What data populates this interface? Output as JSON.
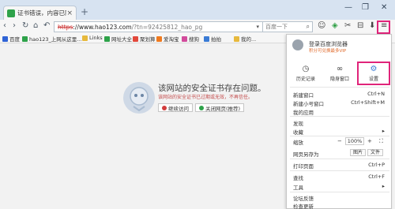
{
  "tab": {
    "label": "证书错误，内容已阻止"
  },
  "window": {
    "minimize": "—",
    "restore": "❐",
    "close": "✕"
  },
  "toolbar": {
    "url_scheme": "https",
    "url_host": "://www.hao123.com",
    "url_rest": "/?tn=92425812_hao_pg",
    "search_placeholder": "百度一下"
  },
  "bookmarks": [
    {
      "label": "百度",
      "color": "#3064d6"
    },
    {
      "label": "hao123_上网从这里...",
      "color": "#2ea24a"
    },
    {
      "label": "Links",
      "color": "#e7b93d"
    },
    {
      "label": "网址大全",
      "color": "#2ea24a"
    },
    {
      "label": "聚划算",
      "color": "#e2483c"
    },
    {
      "label": "爱淘宝",
      "color": "#f07a1f"
    },
    {
      "label": "搜狗",
      "color": "#d24b9c"
    },
    {
      "label": "拍拍",
      "color": "#3a7bd5"
    },
    {
      "label": "我的...",
      "color": "#e7b93d"
    }
  ],
  "error": {
    "title": "该网站的安全证书存在问题。",
    "subtitle": "该网站的安全证书已过期或无效，不再信任。",
    "continue_label": "继续访问",
    "close_label": "关闭网页(推荐)"
  },
  "menu": {
    "login_title": "登录百度浏览器",
    "login_sub": "积分可兑换最多VIP",
    "quick": {
      "history": "历史记录",
      "incognito": "隐身窗口",
      "settings": "设置"
    },
    "items": [
      {
        "label": "新建窗口",
        "shortcut": "Ctrl+N"
      },
      {
        "label": "新建小号窗口",
        "shortcut": "Ctrl+Shift+M"
      },
      {
        "label": "我的应用",
        "shortcut": ""
      },
      {
        "label": "发现",
        "shortcut": ""
      },
      {
        "label": "收藏",
        "shortcut": "▸"
      }
    ],
    "zoom_label": "缩放",
    "zoom_value": "100%",
    "saveas_label": "网页另存为",
    "saveas_img": "图片",
    "saveas_file": "文件",
    "print_label": "打印页面",
    "print_shortcut": "Ctrl+P",
    "find_label": "查找",
    "find_shortcut": "Ctrl+F",
    "tools_label": "工具",
    "tools_arrow": "▸",
    "feedback_label": "论坛反馈",
    "update_label": "检查更新"
  },
  "colors": {
    "highlight": "#e0247a",
    "accent": "#3a7bd5"
  }
}
